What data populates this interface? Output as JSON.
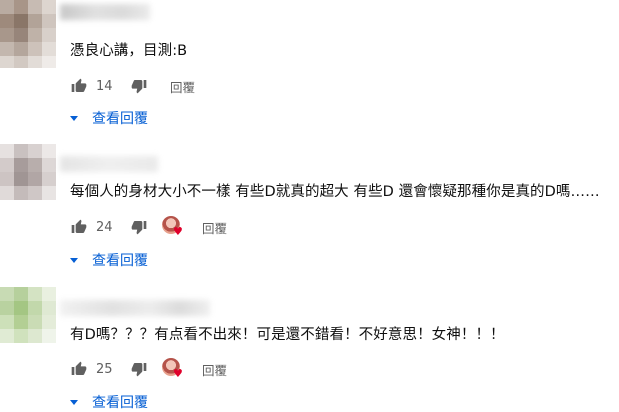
{
  "comments": [
    {
      "text": "憑良心講，目測:B",
      "likes": "14",
      "reply_label": "回覆",
      "view_replies_label": "查看回覆",
      "has_creator_heart": false
    },
    {
      "text": "每個人的身材大小不一樣 有些D就真的超大 有些D 還會懷疑那種你是真的D嗎……",
      "likes": "24",
      "reply_label": "回覆",
      "view_replies_label": "查看回覆",
      "has_creator_heart": true
    },
    {
      "text": "有D嗎？？？有点看不出來！可是還不錯看！不好意思！女神！！！",
      "likes": "25",
      "reply_label": "回覆",
      "view_replies_label": "查看回覆",
      "has_creator_heart": true
    }
  ],
  "icons": {
    "like": "thumbs-up-icon",
    "dislike": "thumbs-down-icon",
    "expand": "triangle-down-icon",
    "creator_heart": "creator-heart-icon"
  },
  "colors": {
    "link": "#065fd4",
    "secondary_text": "#606060",
    "heart": "#e0002b"
  }
}
